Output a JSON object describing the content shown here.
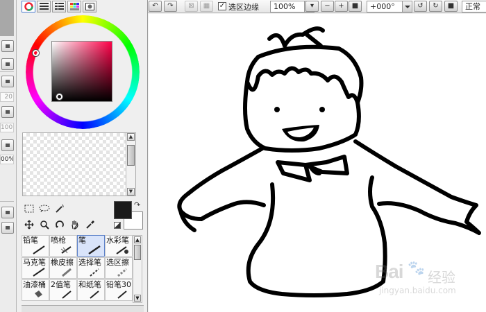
{
  "left_strip": {
    "values": [
      "20",
      "100",
      "00%"
    ]
  },
  "panel": {
    "tabs": [
      {
        "icon": "color-wheel-icon",
        "active": true
      },
      {
        "icon": "list-lines-icon"
      },
      {
        "icon": "list-indent-icon"
      },
      {
        "icon": "swatch-grid-icon"
      },
      {
        "icon": "window-icon"
      }
    ],
    "colors": {
      "hue": "#ff0048",
      "primary": "#1a1a1a",
      "secondary": "#ffffff"
    },
    "tool_icons": [
      {
        "icon": "rect-select-icon"
      },
      {
        "icon": "lasso-icon"
      },
      {
        "icon": "magic-wand-icon"
      },
      {
        "icon": "move-icon"
      },
      {
        "icon": "zoom-icon"
      },
      {
        "icon": "rotate-icon"
      },
      {
        "icon": "hand-icon"
      },
      {
        "icon": "eyedropper-icon"
      }
    ],
    "brushes": [
      {
        "label": "铅笔",
        "selected": false
      },
      {
        "label": "喷枪",
        "selected": false
      },
      {
        "label": "笔",
        "selected": true
      },
      {
        "label": "水彩笔",
        "selected": false
      },
      {
        "label": "马克笔",
        "selected": false
      },
      {
        "label": "橡皮擦",
        "selected": false
      },
      {
        "label": "选择笔",
        "selected": false
      },
      {
        "label": "选区擦",
        "selected": false
      },
      {
        "label": "油漆桶",
        "selected": false
      },
      {
        "label": "2值笔",
        "selected": false
      },
      {
        "label": "和纸笔",
        "selected": false
      },
      {
        "label": "铅笔30",
        "selected": false
      }
    ]
  },
  "toolbar": {
    "selection_edge_label": "选区边缘",
    "selection_edge_checked": true,
    "zoom": "100%",
    "rotation": "+000°",
    "blend_mode": "正常"
  },
  "watermark": {
    "logo": "Bai",
    "cn": "经验",
    "url": "jingyan.baidu.com"
  }
}
